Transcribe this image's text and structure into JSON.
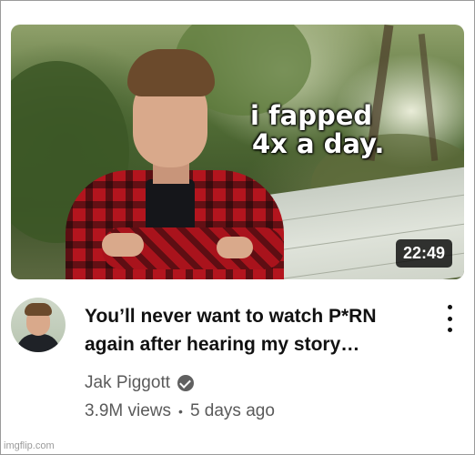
{
  "video": {
    "thumbnail_text": [
      "i fapped",
      "4x a day."
    ],
    "duration": "22:49",
    "title_lines": [
      "You’ll never want to watch P*RN",
      "again after hearing my story…"
    ],
    "channel": "Jak Piggott",
    "views": "3.9M views",
    "separator": "•",
    "age": "5 days ago"
  },
  "icons": {
    "verified": "check-circle-icon",
    "menu": "vertical-ellipsis-icon"
  },
  "watermark": "imgflip.com"
}
